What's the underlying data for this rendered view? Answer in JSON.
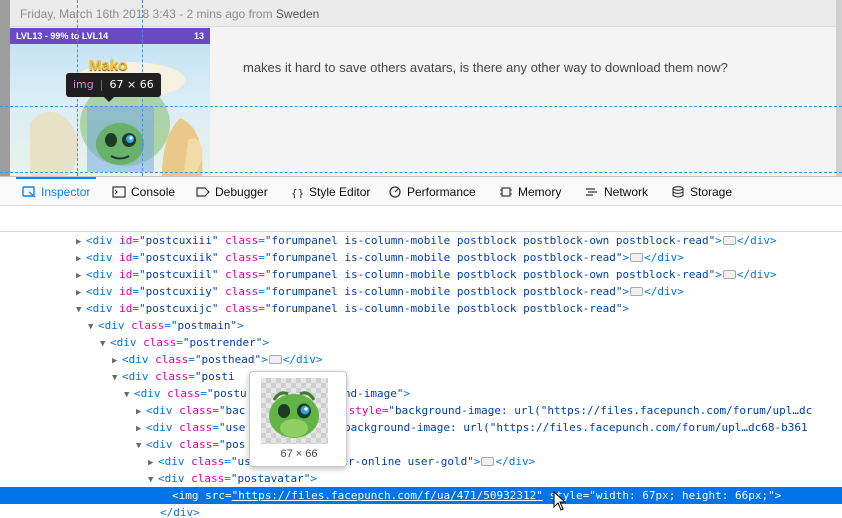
{
  "page": {
    "meta": {
      "date_text": "Friday, March 16th 2018 3:43 - 2 mins ago",
      "from_label": "from",
      "location": "Sweden"
    },
    "user_card": {
      "level_text": "LVL13 - 99% to LVL14",
      "level_number": "13",
      "avatar_name": "Mako"
    },
    "post_text": "makes it hard to save others avatars, is there any other way to download them now?",
    "node_tooltip": {
      "tag": "img",
      "dims": "67 × 66"
    }
  },
  "devtools": {
    "tabs": [
      {
        "label": "Inspector",
        "icon": "inspector-icon",
        "selected": true
      },
      {
        "label": "Console",
        "icon": "console-icon"
      },
      {
        "label": "Debugger",
        "icon": "debugger-icon"
      },
      {
        "label": "Style Editor",
        "icon": "braces-icon"
      },
      {
        "label": "Performance",
        "icon": "performance-icon"
      },
      {
        "label": "Memory",
        "icon": "memory-icon"
      },
      {
        "label": "Network",
        "icon": "network-icon"
      },
      {
        "label": "Storage",
        "icon": "storage-icon"
      }
    ],
    "image_preview": {
      "dims": "67 × 66"
    },
    "markup": {
      "l0": {
        "id": "\"postcuxiii\"",
        "class": "\"forumpanel is-column-mobile postblock postblock-own postblock-read\""
      },
      "l1": {
        "id": "\"postcuxiik\"",
        "class": "\"forumpanel is-column-mobile postblock postblock-read\""
      },
      "l2": {
        "id": "\"postcuxiil\"",
        "class": "\"forumpanel is-column-mobile postblock postblock-own postblock-read\""
      },
      "l3": {
        "id": "\"postcuxiiy\"",
        "class": "\"forumpanel is-column-mobile postblock postblock-read\""
      },
      "l4": {
        "id": "\"postcuxijc\"",
        "class": "\"forumpanel is-column-mobile postblock postblock-read\""
      },
      "l5": {
        "class": "\"postmain\""
      },
      "l6": {
        "class": "\"postrender\""
      },
      "l7": {
        "class": "\"posthead\""
      },
      "l8": {
        "class": "\"posti"
      },
      "l9": {
        "class": "\"postu",
        "rest": "ound-image\""
      },
      "l10": {
        "class": "\"bac",
        "rest": "\"",
        "style_attr": "style",
        "style": "\"background-image: url(\"https://files.facepunch.com/forum/upl…dc"
      },
      "l11": {
        "class": "\"use",
        "style": "\"background-image: url(\"https://files.facepunch.com/forum/upl…dc68-b361"
      },
      "l12": {
        "class": "\"pos"
      },
      "l13": {
        "class": "\"use",
        "rest": "er-online user-gold\""
      },
      "l14": {
        "class": "\"postavatar\""
      },
      "l15": {
        "src": "\"https://files.facepunch.com/f/ua/471/50932312\"",
        "style": "\"width: 67px; height: 66px;\""
      }
    }
  },
  "colors": {
    "accent": "#0a84ff",
    "level_bar": "#6b49c4",
    "selection": "#0074e8",
    "attr_name": "#dd00a9",
    "attr_value": "#003eaa"
  }
}
